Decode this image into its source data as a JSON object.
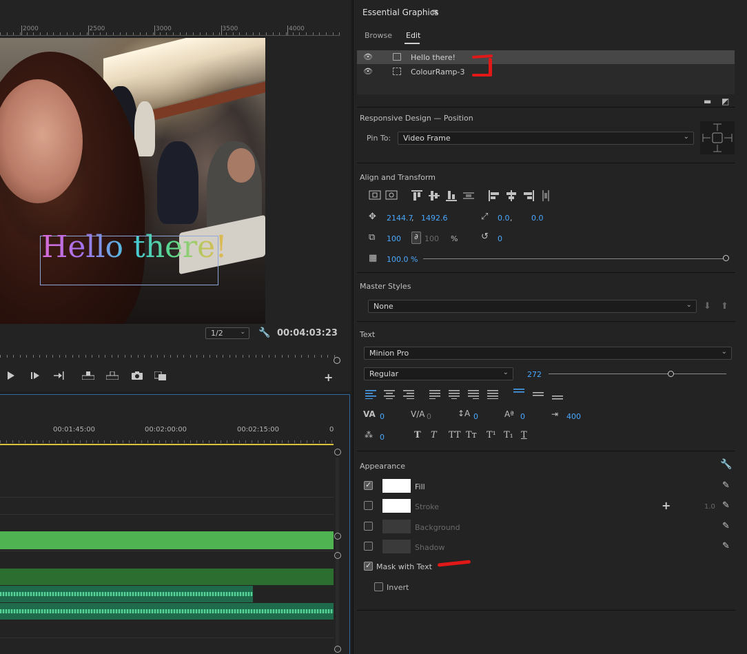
{
  "monitor": {
    "ruler_labels": [
      "2000",
      "2500",
      "3000",
      "3500",
      "4000"
    ],
    "overlay_text": "Hello there!",
    "resolution": "1/2",
    "timecode": "00:04:03:23",
    "transport": {
      "play_icon": "play-icon",
      "step_forward_icon": "step-forward-icon",
      "go_to_out_icon": "go-to-out-icon",
      "lift_icon": "lift-icon",
      "extract_icon": "extract-icon",
      "export_frame_icon": "camera-icon",
      "compare_icon": "compare-icon",
      "add_icon": "plus-icon"
    }
  },
  "timeline": {
    "time_labels": [
      "00:01:45:00",
      "00:02:00:00",
      "00:02:15:00",
      "0"
    ]
  },
  "essential_graphics": {
    "title": "Essential Graphics",
    "tabs": [
      "Browse",
      "Edit"
    ],
    "active_tab": "Edit",
    "layers": [
      {
        "name": "Hello there!",
        "type": "text",
        "selected": true
      },
      {
        "name": "ColourRamp-3",
        "type": "clip",
        "selected": false
      }
    ],
    "responsive": {
      "title": "Responsive Design — Position",
      "pin_label": "Pin To:",
      "pin_value": "Video Frame"
    },
    "align_transform": {
      "title": "Align and Transform",
      "position_x": "2144.7",
      "position_sep": ",",
      "position_y": "1492.6",
      "anchor_x": "0.0",
      "anchor_sep": ",",
      "anchor_y": "0.0",
      "scale": "100",
      "scale_linked": "100",
      "scale_unit": "%",
      "rotation": "0",
      "opacity": "100.0 %",
      "opacity_fraction": 1.0
    },
    "master_styles": {
      "title": "Master Styles",
      "value": "None"
    },
    "text": {
      "title": "Text",
      "font": "Minion Pro",
      "style": "Regular",
      "size": "272",
      "size_fraction": 0.69,
      "tracking": "0",
      "kerning": "0",
      "leading": "0",
      "baseline": "0",
      "tab_width": "400",
      "tsume": "0",
      "faux_styles": [
        "T",
        "T",
        "TT",
        "Tт",
        "T¹",
        "T₁",
        "T"
      ]
    },
    "appearance": {
      "title": "Appearance",
      "fill_label": "Fill",
      "fill_checked": true,
      "fill_color": "#ffffff",
      "stroke_label": "Stroke",
      "stroke_checked": false,
      "stroke_color": "#ffffff",
      "stroke_width": "1.0",
      "background_label": "Background",
      "background_checked": false,
      "shadow_label": "Shadow",
      "shadow_checked": false,
      "mask_label": "Mask with Text",
      "mask_checked": true,
      "invert_label": "Invert",
      "invert_checked": false
    }
  },
  "colors": {
    "accent_blue": "#4aa8ff",
    "panel_bg": "#232323",
    "annotation_red": "#e01818",
    "timeline_green": "#4fb352"
  }
}
